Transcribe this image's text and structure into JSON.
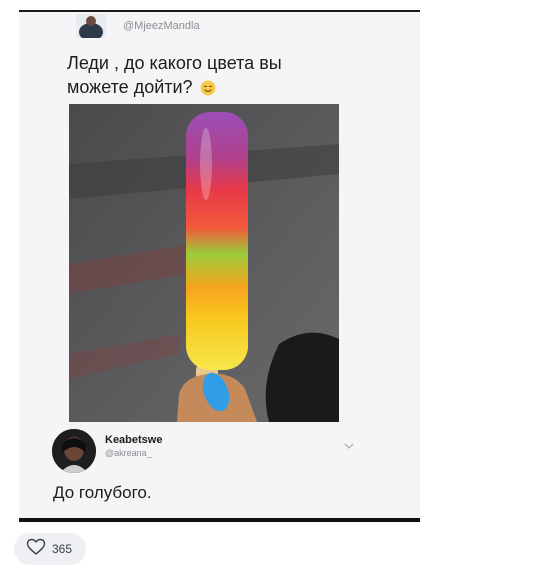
{
  "tweet": {
    "handle": "@MjeezMandla",
    "text": "Леди , до какого цвета вы можете дойти?"
  },
  "reply": {
    "name": "Keabetswe",
    "handle": "@akreana_",
    "text": "До голубого."
  },
  "post": {
    "like_count": "365"
  },
  "colors": {
    "card_bg": "#f5f5f7",
    "like_bg": "#eef0f3",
    "nail": "#2f9ee6"
  },
  "icons": [
    "smiling-emoji-icon",
    "chevron-down-icon",
    "heart-icon"
  ]
}
